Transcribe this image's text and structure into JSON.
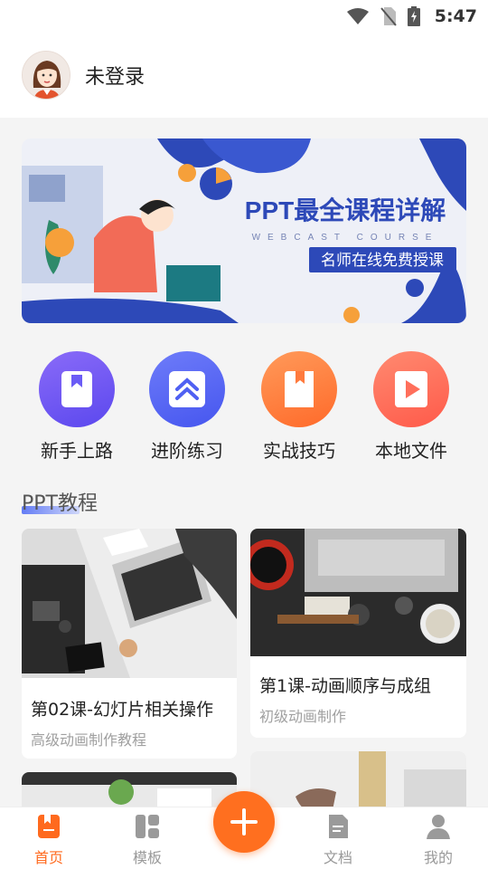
{
  "status_bar": {
    "time": "5:47"
  },
  "header": {
    "username": "未登录"
  },
  "banner": {
    "title": "PPT最全课程详解",
    "subtitle": "WEBCAST COURSE",
    "tagline": "名师在线免费授课"
  },
  "shortcuts": [
    {
      "label": "新手上路",
      "icon": "bookmark-icon",
      "color": "#6b5cf6"
    },
    {
      "label": "进阶练习",
      "icon": "chevron-up-icon",
      "color": "#5a6cf7"
    },
    {
      "label": "实战技巧",
      "icon": "book-icon",
      "color": "#ff7a3d"
    },
    {
      "label": "本地文件",
      "icon": "play-icon",
      "color": "#ff6f5b"
    }
  ],
  "section": {
    "title": "PPT教程"
  },
  "cards": [
    {
      "title": "第02课-幻灯片相关操作",
      "subtitle": "高级动画制作教程"
    },
    {
      "title": "第1课-动画顺序与成组",
      "subtitle": "初级动画制作"
    }
  ],
  "nav": {
    "home": "首页",
    "templates": "模板",
    "docs": "文档",
    "mine": "我的"
  },
  "colors": {
    "accent": "#ff6a1e",
    "banner_blue": "#2d49b8"
  }
}
